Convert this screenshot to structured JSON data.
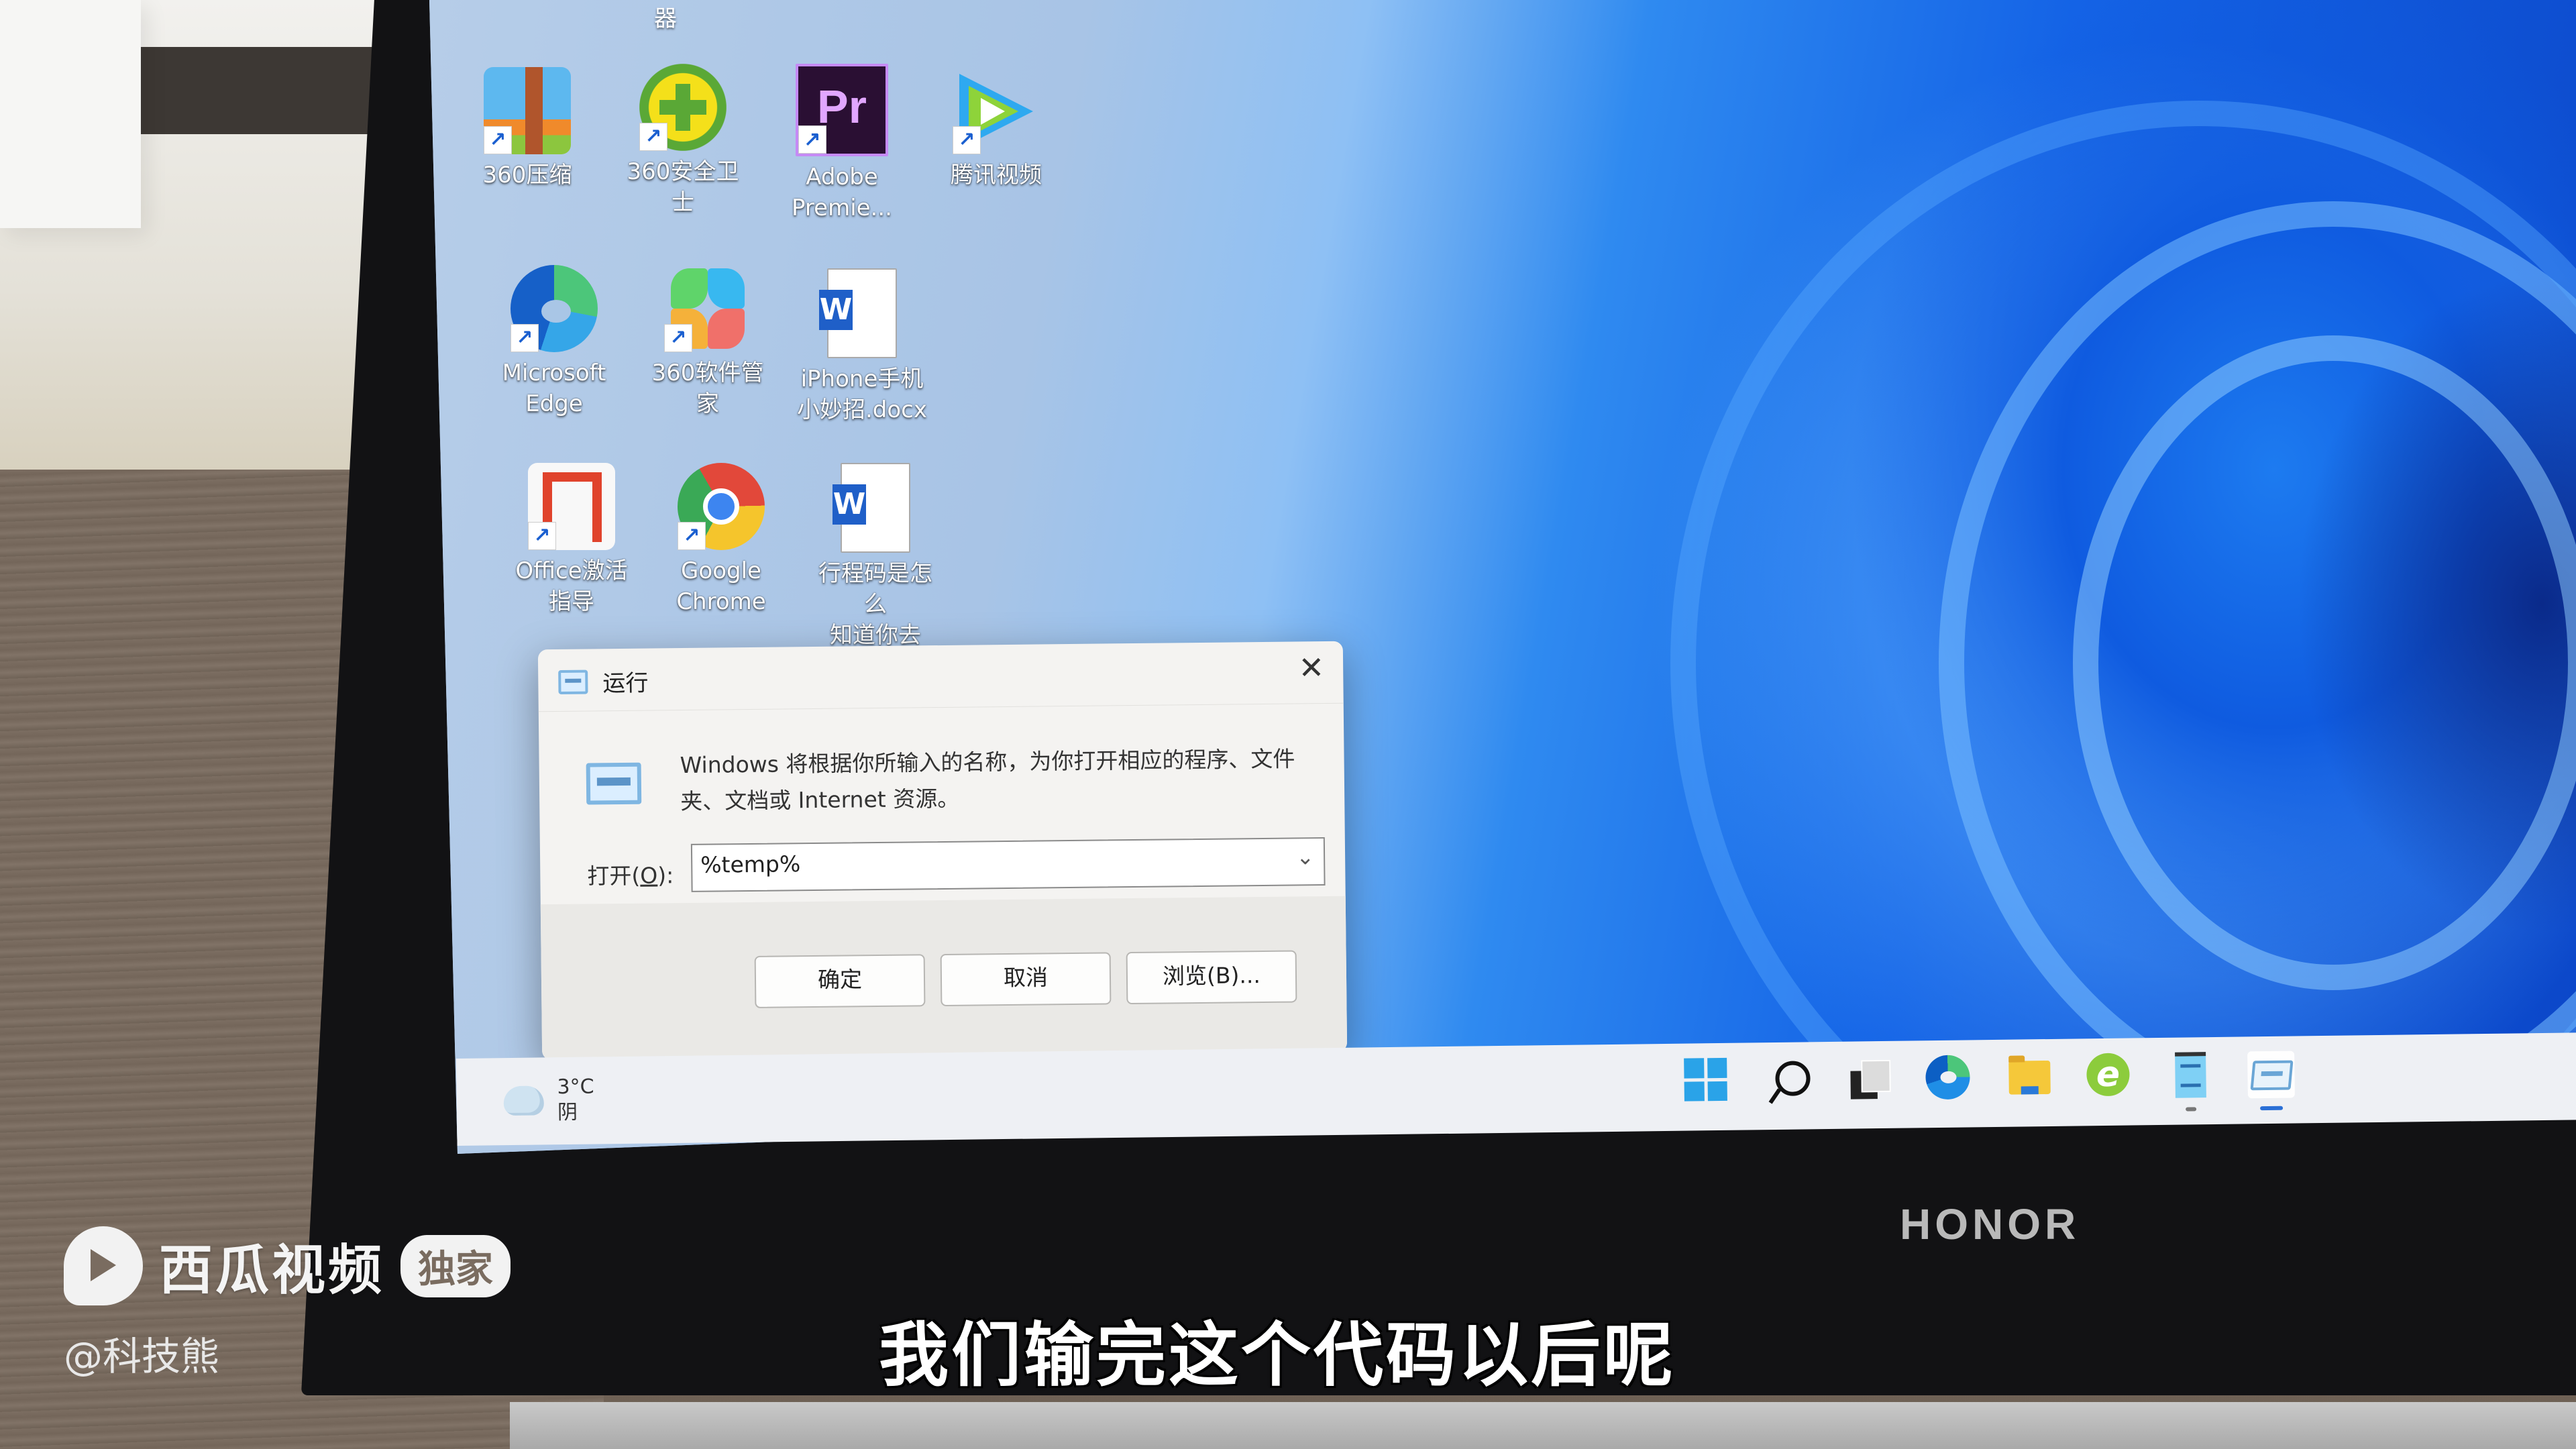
{
  "desktop": {
    "top_partial_label": "器",
    "icons": [
      {
        "label": "360压缩",
        "icon": "360-zip-icon",
        "shortcut": true
      },
      {
        "label": "360安全卫士",
        "icon": "360-security-icon",
        "shortcut": true
      },
      {
        "label": "Adobe\nPremie...",
        "icon": "adobe-premiere-icon",
        "shortcut": true
      },
      {
        "label": "腾讯视频",
        "icon": "tencent-video-icon",
        "shortcut": true
      },
      {
        "label": "Microsoft\nEdge",
        "icon": "edge-icon",
        "shortcut": true
      },
      {
        "label": "360软件管家",
        "icon": "360-software-manager-icon",
        "shortcut": true
      },
      {
        "label": "iPhone手机\n小妙招.docx",
        "icon": "word-document-icon",
        "shortcut": false
      },
      {
        "label": "Office激活\n指导",
        "icon": "office-activation-icon",
        "shortcut": true
      },
      {
        "label": "Google\nChrome",
        "icon": "chrome-icon",
        "shortcut": true
      },
      {
        "label": "行程码是怎么\n知道你去过...",
        "icon": "word-document-icon",
        "shortcut": false
      }
    ]
  },
  "run_dialog": {
    "title": "运行",
    "description": "Windows 将根据你所输入的名称，为你打开相应的程序、文件夹、文档或 Internet 资源。",
    "open_label_prefix": "打开(",
    "open_label_key": "O",
    "open_label_suffix": "):",
    "input_value": "%temp%",
    "buttons": {
      "ok": "确定",
      "cancel": "取消",
      "browse": "浏览(B)..."
    },
    "close_glyph": "✕"
  },
  "taskbar": {
    "weather": {
      "temperature": "3°C",
      "condition": "阴"
    },
    "apps": [
      {
        "name": "start",
        "icon": "windows-start-icon"
      },
      {
        "name": "search",
        "icon": "search-icon"
      },
      {
        "name": "task-view",
        "icon": "task-view-icon"
      },
      {
        "name": "edge",
        "icon": "edge-icon"
      },
      {
        "name": "file-explorer",
        "icon": "folder-icon"
      },
      {
        "name": "360-browser",
        "icon": "ie-browser-icon"
      },
      {
        "name": "notepad",
        "icon": "notepad-icon",
        "running": true
      },
      {
        "name": "run",
        "icon": "run-dialog-icon",
        "active": true
      }
    ]
  },
  "laptop_brand": "HONOR",
  "overlay": {
    "platform": "西瓜视频",
    "badge": "独家",
    "author": "@科技熊",
    "subtitle": "我们输完这个代码以后呢"
  },
  "colors": {
    "wallpaper_blue": "#1463e6",
    "taskbar_bg": "#eef0f4",
    "dialog_bg": "#f4f3f1",
    "start_blue": "#2aa3e8"
  }
}
